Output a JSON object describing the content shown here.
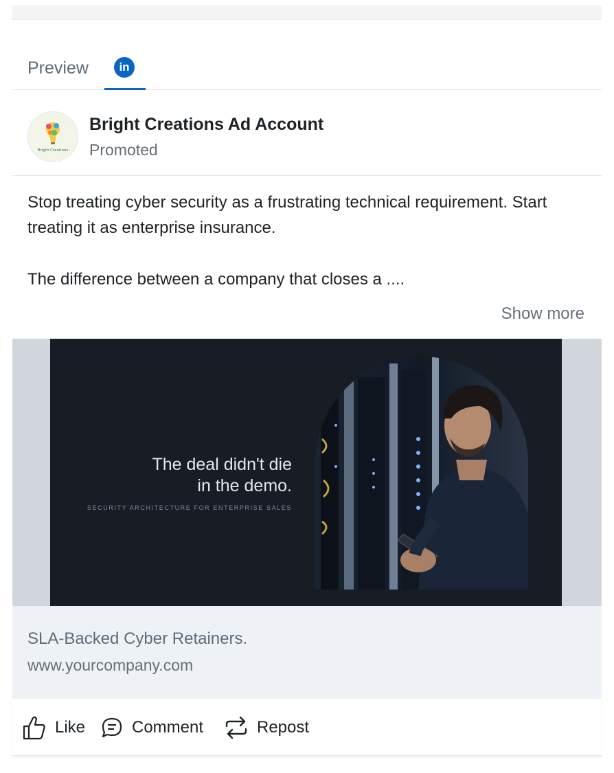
{
  "tabs": {
    "preview_label": "Preview",
    "linkedin_badge": "in"
  },
  "post": {
    "account_name": "Bright Creations Ad Account",
    "sponsored_label": "Promoted",
    "logo_text": "Bright Creations",
    "body_paragraph_1": "Stop treating cyber security as a frustrating technical requirement. Start treating it as enterprise insurance.",
    "body_paragraph_2": "The difference between a company that closes a ....",
    "show_more": "Show more"
  },
  "creative": {
    "headline_line_1": "The deal didn't die",
    "headline_line_2": "in the demo.",
    "tagline": "SECURITY ARCHITECTURE FOR ENTERPRISE SALES"
  },
  "link": {
    "title": "SLA-Backed Cyber Retainers.",
    "url": "www.yourcompany.com"
  },
  "actions": {
    "like": "Like",
    "comment": "Comment",
    "repost": "Repost"
  },
  "colors": {
    "linkedin_blue": "#0a66c2",
    "creative_background": "#181c24",
    "link_area_background": "#eef2f7"
  }
}
